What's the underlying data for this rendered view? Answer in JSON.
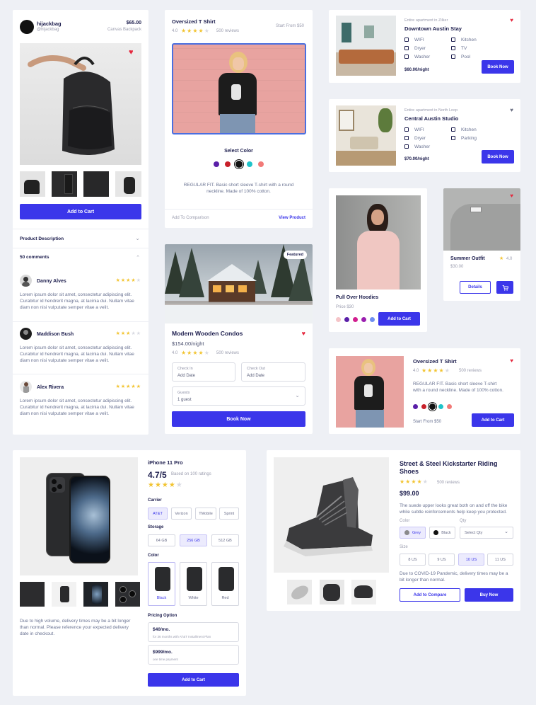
{
  "backpack": {
    "brand": "hijackbag",
    "handle": "@hijackbag",
    "price": "$65.00",
    "product": "Canvas Backpack",
    "add_to_cart": "Add to Cart",
    "description_label": "Product Description",
    "comments_label": "50 comments",
    "comments": [
      {
        "name": "Danny Alves",
        "rating": 4,
        "text": "Lorem ipsum dolor sit amet, consectetur adipiscing elit. Curabitur id hendrerit magna, at lacinia dui. Nullam vitae diam non nisi vulputate semper vitae a velit."
      },
      {
        "name": "Maddison Bush",
        "rating": 3,
        "text": "Lorem ipsum dolor sit amet, consectetur adipiscing elit. Curabitur id hendrerit magna, at lacinia dui. Nullam vitae diam non nisi vulputate semper vitae a velit."
      },
      {
        "name": "Alex Rivera",
        "rating": 5,
        "text": "Lorem ipsum dolor sit amet, consectetur adipiscing elit. Curabitur id hendrerit magna, at lacinia dui. Nullam vitae diam non nisi vulputate semper vitae a velit."
      }
    ]
  },
  "tshirt": {
    "title": "Oversized T Shirt",
    "rating": "4.0",
    "reviews": "500 reviews",
    "start_from": "Start From $50",
    "select_color": "Select Color",
    "colors": [
      "#5a1fa8",
      "#c8202a",
      "#111111",
      "#1fc3c9",
      "#f27a78"
    ],
    "description": "REGULAR FIT. Basic short sleeve T-shirt with a round neckline. Made of 100% cotton.",
    "add_comparison": "Add To Comparison",
    "view_product": "View Product"
  },
  "condos": {
    "badge": "Featured",
    "title": "Modern Wooden Condos",
    "price": "$154.00/night",
    "rating": "4.0",
    "reviews": "500 reviews",
    "check_in_label": "Check In",
    "check_in_value": "Add Date",
    "check_out_label": "Check Out",
    "check_out_value": "Add Date",
    "guests_label": "Guests",
    "guests_value": "1 guest",
    "book": "Book Now"
  },
  "stays": [
    {
      "subtitle": "Entire apartment in Zilker",
      "title": "Downtown Austin Stay",
      "price": "$60.00/night",
      "book": "Book Now",
      "amenities_left": [
        "WIFI",
        "Dryer",
        "Washer"
      ],
      "amenities_right": [
        "Kitchen",
        "TV",
        "Pool"
      ],
      "favorite": true
    },
    {
      "subtitle": "Entire apartment in North Loop",
      "title": "Central Austin Studio",
      "price": "$70.00/night",
      "book": "Book Now",
      "amenities_left": [
        "WIFI",
        "Dryer",
        "Washer"
      ],
      "amenities_right": [
        "Kitchen",
        "Parking"
      ],
      "favorite": false
    }
  ],
  "hoodie": {
    "title": "Pull Over Hoodies",
    "price": "Price $30",
    "add_to_cart": "Add to Cart",
    "colors": [
      "#f5c4c8",
      "#5a1fa8",
      "#d21f8f",
      "#9b1fb0",
      "#6f8ff0"
    ]
  },
  "summer": {
    "title": "Summer Outfit",
    "rating": "4.0",
    "price": "$30.00",
    "details": "Details"
  },
  "tshirt2": {
    "title": "Oversized T Shirt",
    "rating": "4.0",
    "reviews": "500 reviews",
    "description": "REGULAR FIT. Basic short sleeve T-shirt with a round neckline. Made of 100% cotton.",
    "colors": [
      "#5a1fa8",
      "#c8202a",
      "#111111",
      "#1fc3c9",
      "#f27a78"
    ],
    "start_from": "Start From $50",
    "add_to_cart": "Add to Cart"
  },
  "iphone": {
    "title": "iPhone 11 Pro",
    "score": "4.7/5",
    "based_on": "Based on 100 ratings",
    "delivery_note": "Due to high volume, delivery times may be a bit longer than normal. Please reference your expected delivery date in checkout.",
    "carrier_label": "Carrier",
    "carriers": [
      "AT&T",
      "Verizon",
      "TMobile",
      "Sprint"
    ],
    "storage_label": "Storage",
    "storage": [
      "64 GB",
      "256 GB",
      "512 GB"
    ],
    "color_label": "Color",
    "colors": [
      "Black",
      "White",
      "Red"
    ],
    "pricing_label": "Pricing Option",
    "pricing": [
      {
        "price": "$40/mo.",
        "note": "for 36 months with AT&T Installment Plan"
      },
      {
        "price": "$999/mo.",
        "note": "one time payment"
      }
    ],
    "add_to_cart": "Add to Cart"
  },
  "shoe": {
    "title": "Street & Steel Kickstarter Riding Shoes",
    "reviews": "500 reviews",
    "price": "$99.00",
    "description": "The suede upper looks great both on and off the bike while subtle reinforcements help keep you protected.",
    "color_label": "Color",
    "qty_label": "Qty",
    "colors": [
      "Grey",
      "Black"
    ],
    "qty_placeholder": "Select Qty",
    "size_label": "Size",
    "sizes": [
      "8 US",
      "9 US",
      "10 US",
      "11 US"
    ],
    "delivery_note": "Due to COVID-19 Pandemic, delivery times may be a bit longer than normal.",
    "add_compare": "Add to Compare",
    "buy_now": "Buy Now"
  }
}
